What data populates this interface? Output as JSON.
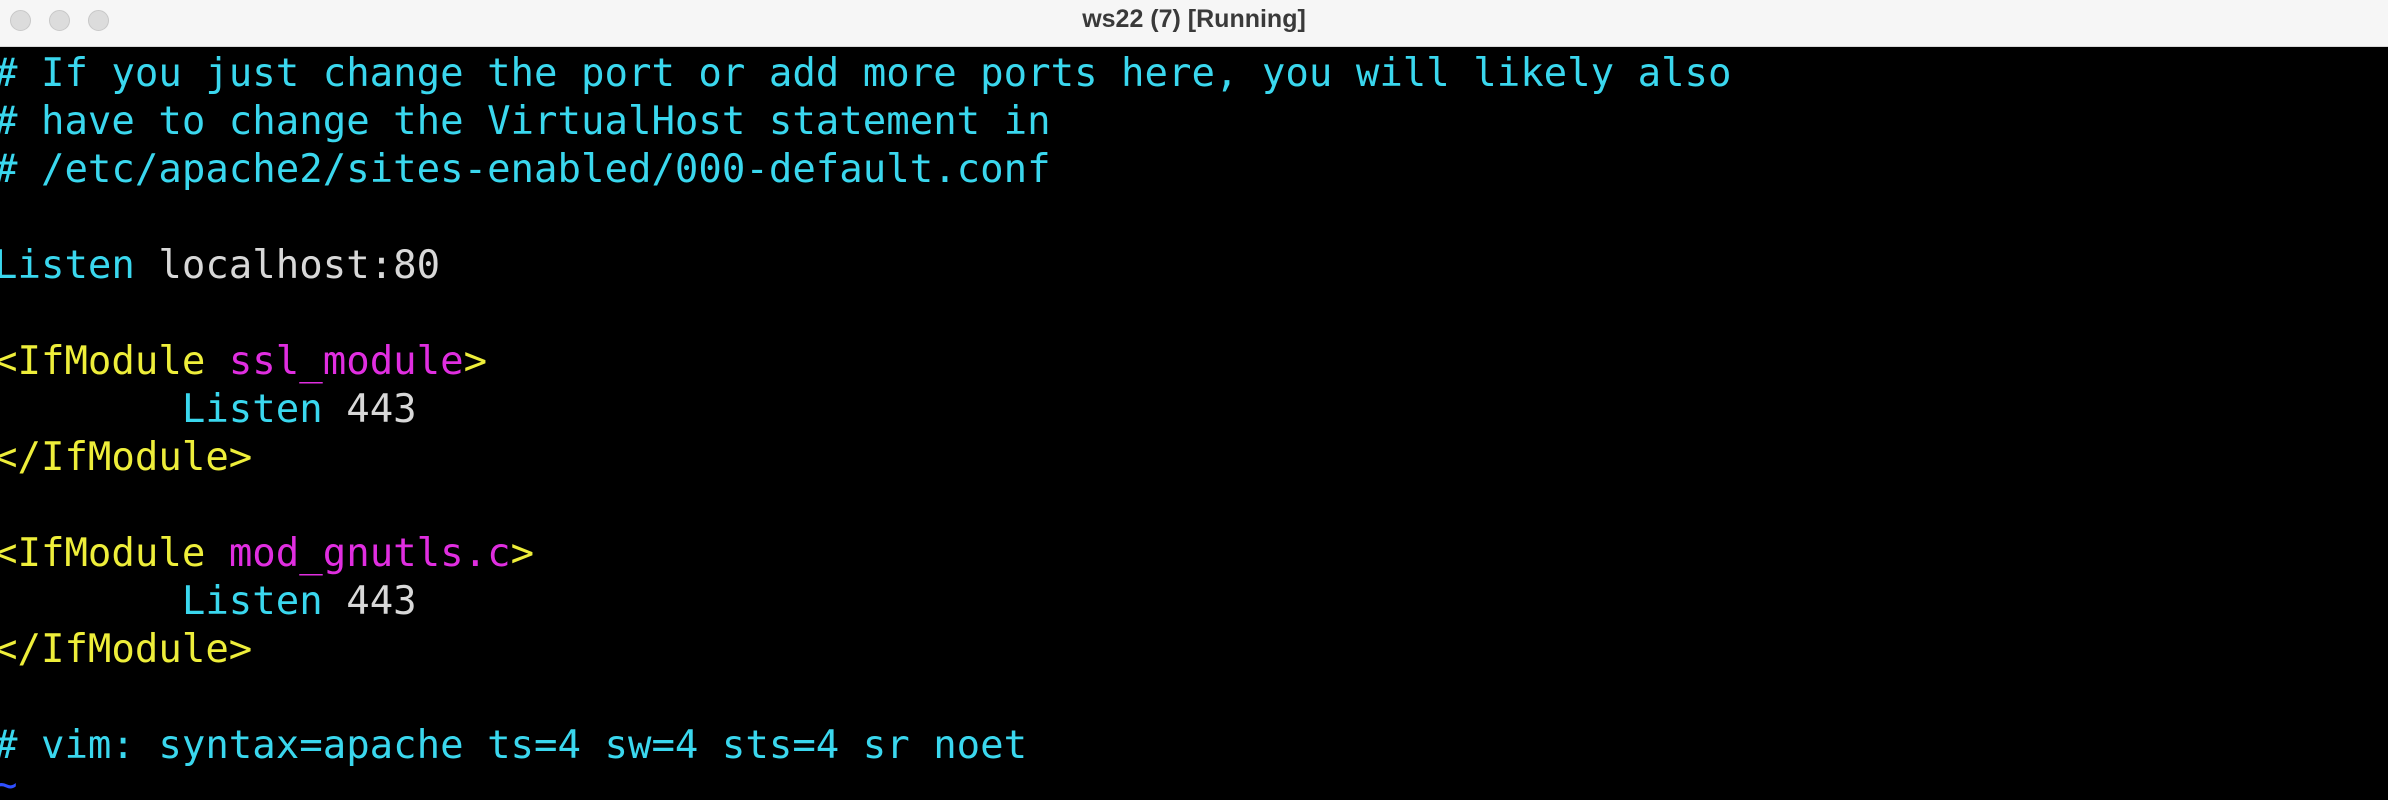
{
  "window": {
    "title": "ws22 (7) [Running]"
  },
  "colors": {
    "comment": "#3ad7ee",
    "keyword": "#3ad7ee",
    "plain": "#d8d8d8",
    "tag": "#eeee3a",
    "module": "#e02ee0",
    "tilde": "#2f4fff",
    "background": "#000000"
  },
  "editor": {
    "comment1": "# If you just change the port or add more ports here, you will likely also",
    "comment2": "# have to change the VirtualHost statement in",
    "comment3": "# /etc/apache2/sites-enabled/000-default.conf",
    "listen_keyword": "Listen",
    "listen_value": " localhost:80",
    "block1": {
      "open_tag": "<IfModule ",
      "module": "ssl_module",
      "open_close": ">",
      "indent": "        ",
      "keyword": "Listen",
      "value": " 443",
      "close_tag": "</IfModule>"
    },
    "block2": {
      "open_tag": "<IfModule ",
      "module": "mod_gnutls.c",
      "open_close": ">",
      "indent": "        ",
      "keyword": "Listen",
      "value": " 443",
      "close_tag": "</IfModule>"
    },
    "modeline": "# vim: syntax=apache ts=4 sw=4 sts=4 sr noet",
    "tilde": "~"
  }
}
